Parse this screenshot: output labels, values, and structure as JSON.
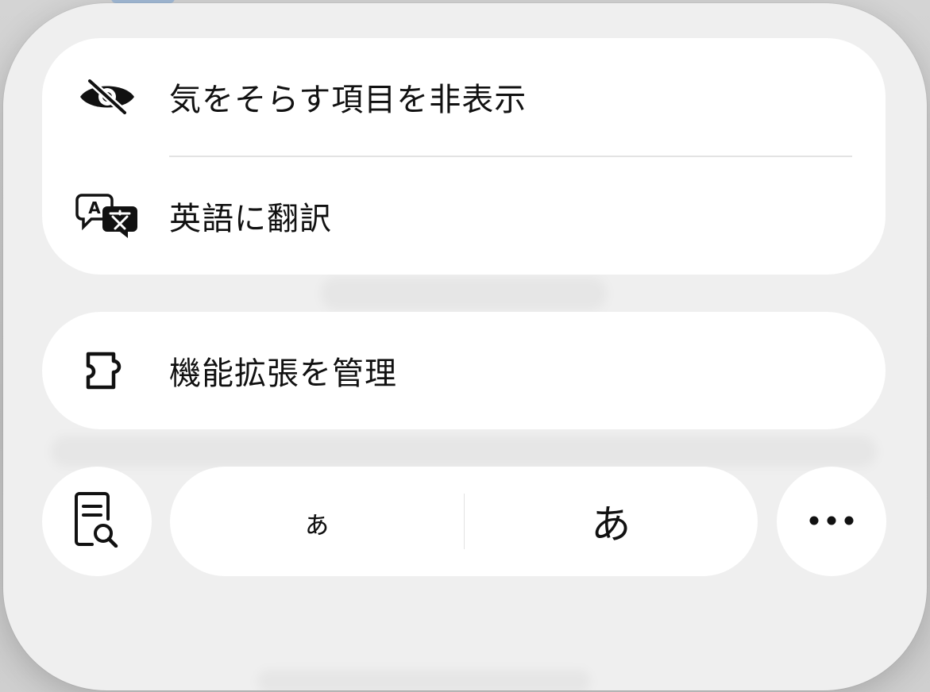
{
  "menu": {
    "items": [
      {
        "label": "気をそらす項目を非表示",
        "icon": "eye-slash-icon"
      },
      {
        "label": "英語に翻訳",
        "icon": "translate-icon"
      }
    ],
    "extensions": {
      "label": "機能拡張を管理",
      "icon": "puzzle-piece-icon"
    }
  },
  "toolbar": {
    "reader_icon": "reader-search-icon",
    "font_smaller_label": "ぁ",
    "font_larger_label": "あ",
    "more_icon": "ellipsis-icon"
  },
  "colors": {
    "sheet": "#efefef",
    "card": "#ffffff",
    "text": "#111111"
  }
}
